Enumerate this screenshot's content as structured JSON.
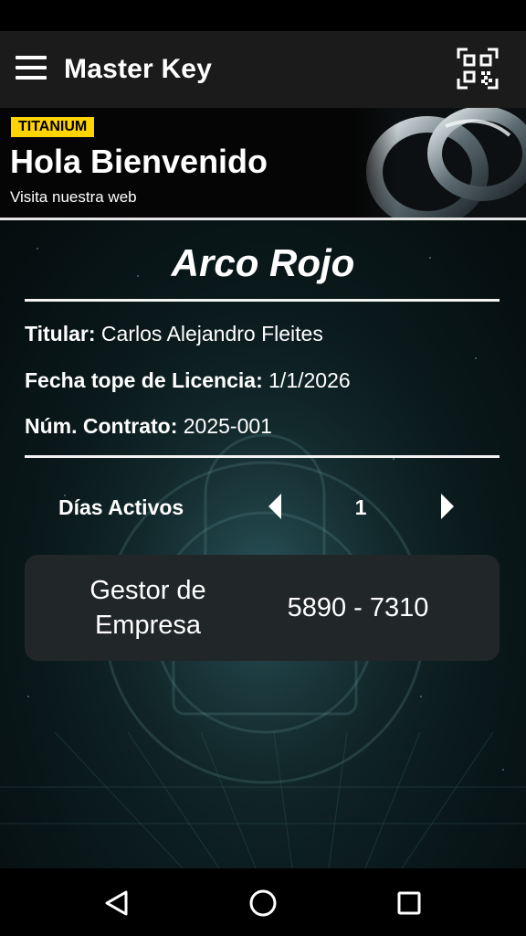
{
  "app": {
    "title": "Master Key"
  },
  "icons": {
    "menu": "menu-icon",
    "qr": "qr-code-icon",
    "prev": "arrow-left-icon",
    "next": "arrow-right-icon",
    "back": "nav-back-icon",
    "home": "nav-home-icon",
    "recent": "nav-recent-icon"
  },
  "banner": {
    "badge": "TITANIUM",
    "title": "Hola Bienvenido",
    "link": "Visita nuestra web"
  },
  "license": {
    "organization": "Arco Rojo",
    "holder_label": "Titular:",
    "holder_value": "Carlos Alejandro Fleites",
    "expiry_label": "Fecha tope de Licencia:",
    "expiry_value": "1/1/2026",
    "contract_label": "Núm. Contrato:",
    "contract_value": "2025-001"
  },
  "days": {
    "label": "Días Activos",
    "value": "1"
  },
  "card": {
    "label": "Gestor de Empresa",
    "value": "5890 - 7310"
  },
  "colors": {
    "badge": "#ffd400",
    "appbar": "#1b1b1b",
    "card": "#212629"
  }
}
